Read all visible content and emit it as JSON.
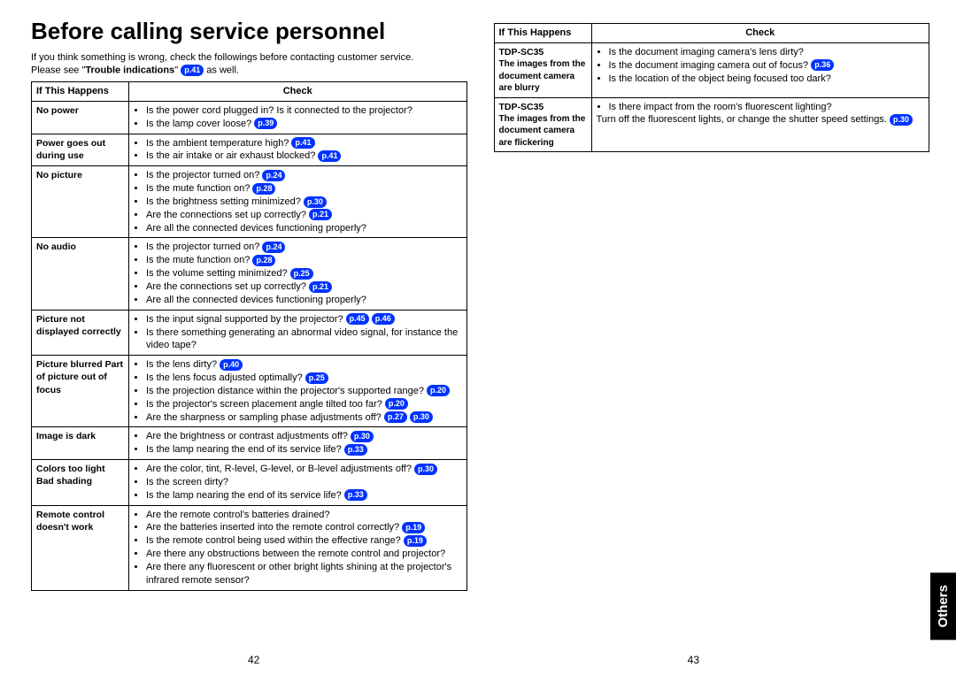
{
  "title": "Before calling service personnel",
  "intro_line1": "If you think something is wrong, check the followings before contacting customer service.",
  "intro_line2_prefix": "Please see \"",
  "intro_line2_bold": "Trouble indications",
  "intro_line2_mid": "\" ",
  "intro_line2_ref": "p.41",
  "intro_line2_suffix": "  as well.",
  "header_if": "If  This Happens",
  "header_check": "Check",
  "left_rows": [
    {
      "if": "No power",
      "checks": [
        {
          "text": "Is the power cord plugged in? Is it connected to the projector?"
        },
        {
          "text": "Is the lamp cover loose? ",
          "refs": [
            "p.39"
          ]
        }
      ]
    },
    {
      "if": "Power goes out during use",
      "checks": [
        {
          "text": "Is the ambient temperature high? ",
          "refs": [
            "p.41"
          ]
        },
        {
          "text": "Is the air intake or air exhaust blocked? ",
          "refs": [
            "p.41"
          ]
        }
      ]
    },
    {
      "if": "No picture",
      "checks": [
        {
          "text": "Is the projector turned on? ",
          "refs": [
            "p.24"
          ]
        },
        {
          "text": "Is the mute function on? ",
          "refs": [
            "p.28"
          ]
        },
        {
          "text": "Is the brightness setting minimized? ",
          "refs": [
            "p.30"
          ]
        },
        {
          "text": "Are the connections set up correctly? ",
          "refs": [
            "p.21"
          ]
        },
        {
          "text": "Are all the connected devices functioning properly?"
        }
      ]
    },
    {
      "if": "No audio",
      "checks": [
        {
          "text": "Is the projector turned on? ",
          "refs": [
            "p.24"
          ]
        },
        {
          "text": "Is the mute function on? ",
          "refs": [
            "p.28"
          ]
        },
        {
          "text": "Is the volume setting minimized? ",
          "refs": [
            "p.25"
          ]
        },
        {
          "text": "Are the connections set up correctly? ",
          "refs": [
            "p.21"
          ]
        },
        {
          "text": "Are all the connected devices functioning properly?"
        }
      ]
    },
    {
      "if": "Picture not displayed correctly",
      "checks": [
        {
          "text": "Is the input signal supported by the projector? ",
          "refs": [
            "p.45",
            "p.46"
          ]
        },
        {
          "text": "Is there something generating an abnormal video signal, for instance the video tape?"
        }
      ]
    },
    {
      "if": "Picture blurred Part of picture out of focus",
      "checks": [
        {
          "text": "Is the lens dirty? ",
          "refs": [
            "p.40"
          ]
        },
        {
          "text": "Is the lens focus adjusted optimally? ",
          "refs": [
            "p.25"
          ]
        },
        {
          "text": "Is the projection distance within the projector's supported range? ",
          "refs": [
            "p.20"
          ]
        },
        {
          "text": "Is the projector's screen placement angle tilted too far?  ",
          "refs": [
            "p.20"
          ]
        },
        {
          "text": "Are the sharpness or sampling phase adjustments off? ",
          "refs": [
            "p.27",
            "p.30"
          ]
        }
      ]
    },
    {
      "if": "Image is dark",
      "checks": [
        {
          "text": "Are the brightness or contrast adjustments off? ",
          "refs": [
            "p.30"
          ]
        },
        {
          "text": "Is the lamp nearing the end of its service life? ",
          "refs": [
            "p.33"
          ]
        }
      ]
    },
    {
      "if": "Colors too light Bad shading",
      "checks": [
        {
          "text": "Are the color, tint, R-level, G-level, or B-level adjustments off? ",
          "refs": [
            "p.30"
          ]
        },
        {
          "text": "Is the screen dirty?"
        },
        {
          "text": "Is the lamp nearing the end of its service life? ",
          "refs": [
            "p.33"
          ]
        }
      ]
    },
    {
      "if": "Remote control doesn't work",
      "checks": [
        {
          "text": "Are the remote control's batteries drained?"
        },
        {
          "text": "Are the batteries inserted into the remote control correctly? ",
          "refs": [
            "p.19"
          ]
        },
        {
          "text": "Is the remote control being used within the effective range? ",
          "refs": [
            "p.19"
          ]
        },
        {
          "text": "Are there any obstructions between the remote control and projector?"
        },
        {
          "text": "Are there any fluorescent or other bright lights shining at the projector's infrared remote sensor?"
        }
      ]
    }
  ],
  "right_rows": [
    {
      "if_model": "TDP-SC35",
      "if_desc": "The images from the document camera are blurry",
      "checks": [
        {
          "text": "Is the document imaging camera's lens dirty?"
        },
        {
          "text": "Is the document imaging camera out of focus? ",
          "refs": [
            "p.36"
          ]
        },
        {
          "text": "Is the location of the object being focused too dark?"
        }
      ]
    },
    {
      "if_model": "TDP-SC35",
      "if_desc": "The images from the document camera are flickering",
      "checks": [
        {
          "text": "Is there impact from the room's fluorescent lighting?"
        },
        {
          "text_plain": "Turn off the fluorescent lights, or change the shutter speed settings. ",
          "refs": [
            "p.30"
          ]
        }
      ]
    }
  ],
  "page_left": "42",
  "page_right": "43",
  "side_tab": "Others"
}
